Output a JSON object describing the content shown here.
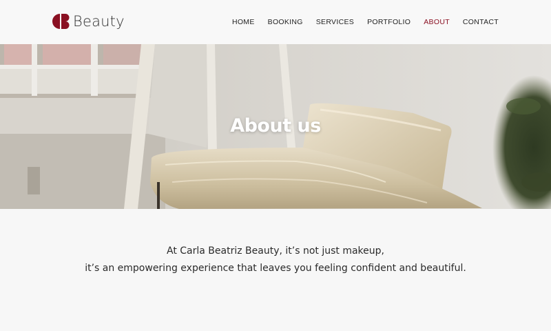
{
  "brand": {
    "name": "Beauty",
    "accent_color": "#8a1022",
    "logo_icon": "cb-monogram-logo"
  },
  "nav": {
    "items": [
      {
        "label": "HOME",
        "active": false
      },
      {
        "label": "BOOKING",
        "active": false
      },
      {
        "label": "SERVICES",
        "active": false
      },
      {
        "label": "PORTFOLIO",
        "active": false
      },
      {
        "label": "ABOUT",
        "active": true
      },
      {
        "label": "CONTACT",
        "active": false
      }
    ]
  },
  "hero": {
    "title": "About us",
    "image": "interior-photo-leather-chaise"
  },
  "intro": {
    "line1": "At Carla Beatriz Beauty, it’s not just makeup,",
    "line2": "it’s an empowering experience that leaves you feeling confident and beautiful."
  }
}
